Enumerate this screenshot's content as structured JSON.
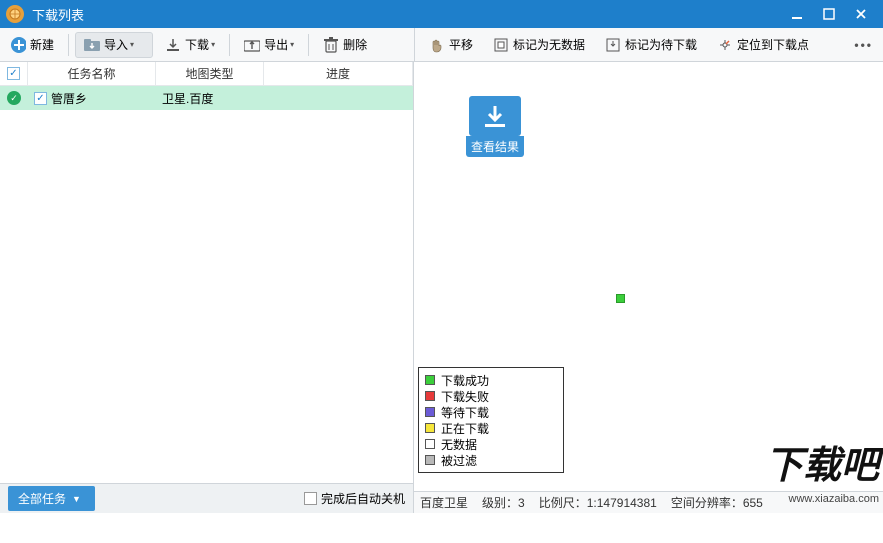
{
  "titlebar": {
    "title": "下载列表"
  },
  "toolbar": {
    "new_btn": "新建",
    "import_btn": "导入",
    "download_btn": "下载",
    "export_btn": "导出",
    "delete_btn": "删除",
    "pan_btn": "平移",
    "mark_nodata_btn": "标记为无数据",
    "mark_pending_btn": "标记为待下载",
    "locate_btn": "定位到下载点"
  },
  "list": {
    "header": {
      "name": "任务名称",
      "maptype": "地图类型",
      "progress": "进度"
    },
    "rows": [
      {
        "checked": true,
        "status": "done",
        "name": "管厝乡",
        "maptype": "卫星.百度",
        "progress": ""
      }
    ]
  },
  "bottom": {
    "all_tasks": "全部任务",
    "auto_shutdown": "完成后自动关机"
  },
  "view_result": {
    "label": "查看结果"
  },
  "legend": {
    "items": [
      {
        "color": "#3bce3b",
        "label": "下载成功"
      },
      {
        "color": "#e63a3a",
        "label": "下载失败"
      },
      {
        "color": "#6b5bd6",
        "label": "等待下载"
      },
      {
        "color": "#f6e63b",
        "label": "正在下载"
      },
      {
        "color": "#ffffff",
        "label": "无数据"
      },
      {
        "color": "#b8b8b8",
        "label": "被过滤"
      }
    ]
  },
  "status": {
    "source": "百度卫星",
    "level_label": "级别：",
    "level": "3",
    "scale_label": "比例尺：",
    "scale": "1:147914381",
    "res_label": "空间分辨率：",
    "res": "655"
  },
  "watermark": {
    "text": "下载吧",
    "url": "www.xiazaiba.com"
  }
}
